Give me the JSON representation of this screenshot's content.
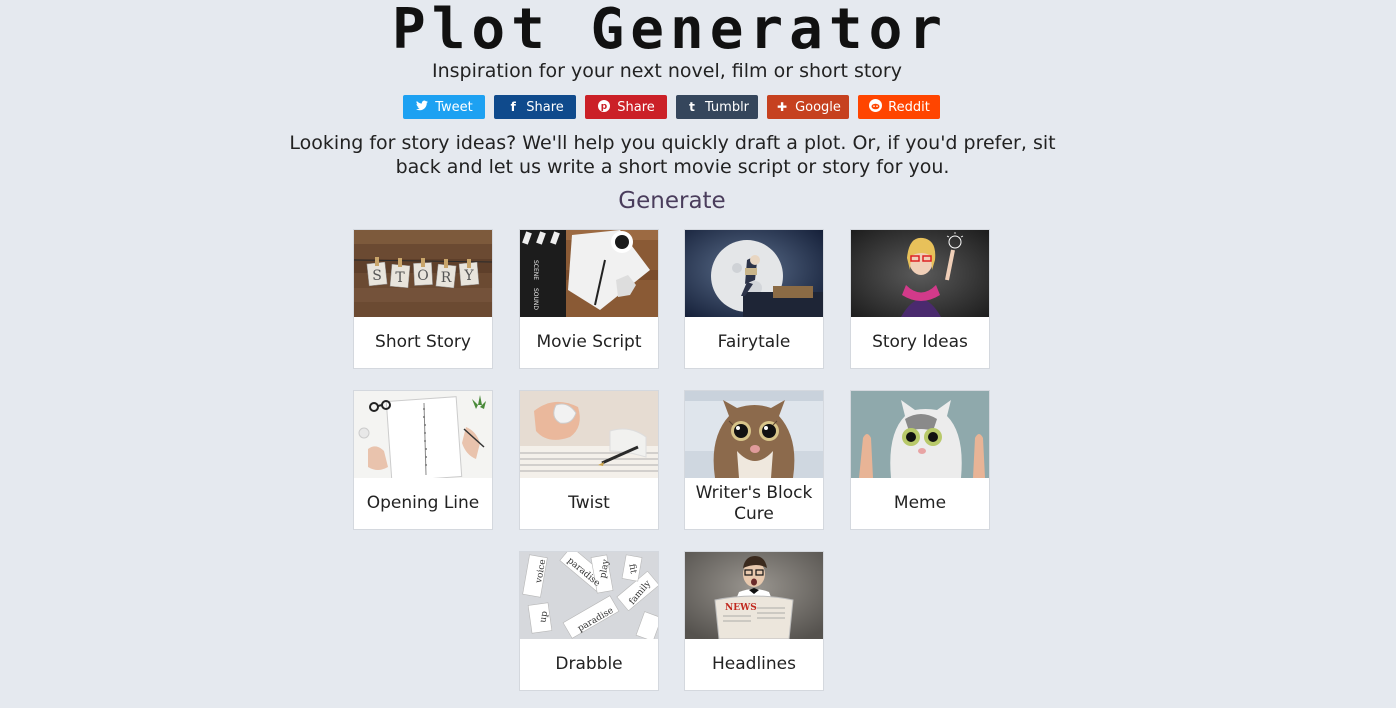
{
  "header": {
    "title": "Plot Generator",
    "tagline": "Inspiration for your next novel, film or short story"
  },
  "share": [
    {
      "label": "Tweet",
      "icon": "twitter-icon",
      "color": "#1da1f2"
    },
    {
      "label": "Share",
      "icon": "facebook-icon",
      "color": "#0f4a8c"
    },
    {
      "label": "Share",
      "icon": "pinterest-icon",
      "color": "#cb2027"
    },
    {
      "label": "Tumblr",
      "icon": "tumblr-icon",
      "color": "#35465c"
    },
    {
      "label": "Google",
      "icon": "google-plus-icon",
      "color": "#c6411f"
    },
    {
      "label": "Reddit",
      "icon": "reddit-icon",
      "color": "#ff4500"
    }
  ],
  "intro": "Looking for story ideas? We'll help you quickly draft a plot. Or, if you'd prefer, sit back and let us write a short movie script or story for you.",
  "generate": {
    "heading": "Generate",
    "cards": [
      {
        "label": "Short Story"
      },
      {
        "label": "Movie Script"
      },
      {
        "label": "Fairytale"
      },
      {
        "label": "Story Ideas"
      },
      {
        "label": "Opening Line"
      },
      {
        "label": "Twist"
      },
      {
        "label": "Writer's Block Cure"
      },
      {
        "label": "Meme"
      },
      {
        "label": "Drabble"
      },
      {
        "label": "Headlines"
      }
    ]
  }
}
